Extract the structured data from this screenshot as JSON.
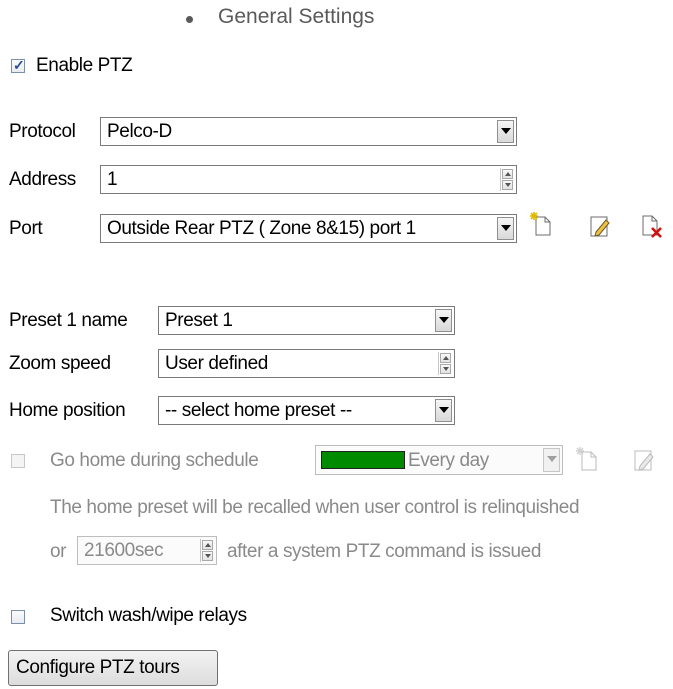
{
  "heading": "General Settings",
  "enable_ptz": {
    "label": "Enable PTZ",
    "checked": true
  },
  "protocol": {
    "label": "Protocol",
    "value": "Pelco-D"
  },
  "address": {
    "label": "Address",
    "value": "1"
  },
  "port": {
    "label": "Port",
    "value": "Outside Rear PTZ ( Zone 8&15) port 1"
  },
  "preset": {
    "label": "Preset 1 name",
    "value": "Preset 1"
  },
  "zoom": {
    "label": "Zoom speed",
    "value": "User defined"
  },
  "home": {
    "label": "Home position",
    "value": "-- select home preset --"
  },
  "schedule": {
    "label": "Go home during schedule",
    "value": "Every day",
    "color": "#008a00"
  },
  "note": {
    "line1": "The home preset will be recalled when user control is relinquished",
    "prefix": "or",
    "seconds": "21600sec",
    "suffix": "after a system PTZ command is issued"
  },
  "wash_wipe": {
    "label": "Switch wash/wipe relays"
  },
  "configure_button": "Configure PTZ tours",
  "icons": {
    "new": "new-icon",
    "edit": "edit-icon",
    "delete": "delete-icon"
  }
}
